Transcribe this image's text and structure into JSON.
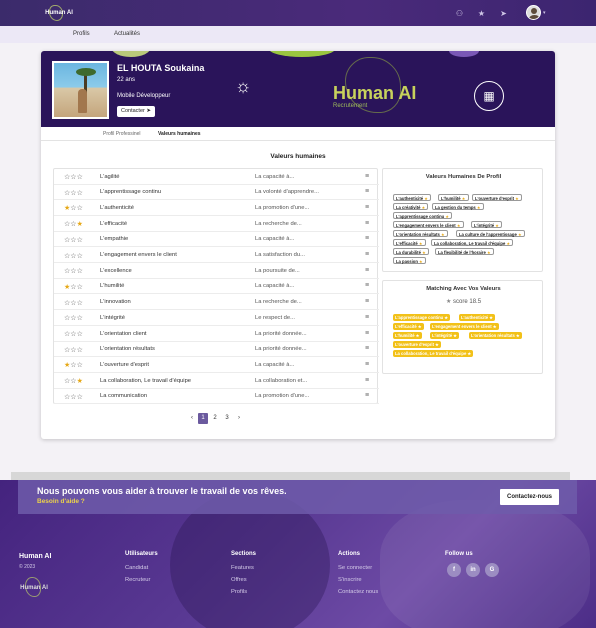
{
  "topbar": {
    "logo": "Human AI",
    "icons": [
      "add-user-icon",
      "star-icon",
      "send-icon"
    ],
    "caret": "▾"
  },
  "subnav": {
    "items": [
      "Profils",
      "Actualités"
    ]
  },
  "profile": {
    "name": "EL HOUTA Soukaina",
    "age": "22 ans",
    "role": "Mobile Développeur",
    "contact": "Contacter"
  },
  "brand": {
    "title": "Human AI",
    "subtitle": "Recrutement"
  },
  "tabs": [
    "Profil Professinel",
    "Valeurs humaines"
  ],
  "section_title": "Valeurs humaines",
  "values": [
    {
      "label": "L'agilité",
      "desc": "La capacité à...",
      "stars": 0
    },
    {
      "label": "L'apprentissage continu",
      "desc": "La volonté d'apprendre...",
      "stars": 0
    },
    {
      "label": "L'authenticité",
      "desc": "La promotion d'une...",
      "stars": 1
    },
    {
      "label": "L'efficacité",
      "desc": "La recherche de...",
      "stars": 3
    },
    {
      "label": "L'empathie",
      "desc": "La capacité à...",
      "stars": 0
    },
    {
      "label": "L'engagement envers le client",
      "desc": "La satisfaction du...",
      "stars": 0
    },
    {
      "label": "L'excellence",
      "desc": "La poursuite de...",
      "stars": 0
    },
    {
      "label": "L'humilité",
      "desc": "La capacité à...",
      "stars": 1
    },
    {
      "label": "L'innovation",
      "desc": "La recherche de...",
      "stars": 0
    },
    {
      "label": "L'intégrité",
      "desc": "Le respect de...",
      "stars": 0
    },
    {
      "label": "L'orientation client",
      "desc": "La priorité donnée...",
      "stars": 0
    },
    {
      "label": "L'orientation résultats",
      "desc": "La priorité donnée...",
      "stars": 0
    },
    {
      "label": "L'ouverture d'esprit",
      "desc": "La capacité à...",
      "stars": 1
    },
    {
      "label": "La collaboration, Le travail d'équipe",
      "desc": "La collaboration et...",
      "stars": 3
    },
    {
      "label": "La communication",
      "desc": "La promotion d'une...",
      "stars": 0
    }
  ],
  "pager": {
    "prev": "‹",
    "pages": [
      "1",
      "2",
      "3"
    ],
    "next": "›"
  },
  "profile_values": {
    "title": "Valeurs Humaines De Profil",
    "tags": [
      "L'authenticité",
      "L'humilité",
      "L'ouverture d'esprit",
      "La créativité",
      "La gestion du temps",
      "L'apprentissage continu",
      "L'engagement envers le client",
      "L'intégrité",
      "L'orientation résultats",
      "La culture de l'apprentissage",
      "L'efficacité",
      "La collaboration, Le travail d'équipe",
      "La durabilité",
      "La flexibilité de l'horaire",
      "La passion"
    ]
  },
  "matching": {
    "title": "Matching Avec Vos Valeurs",
    "score_label": "score",
    "score": "18.5",
    "tags": [
      "L'apprentissage continu",
      "L'authenticité",
      "L'efficacité",
      "L'engagement envers le client",
      "L'humilité",
      "L'intégrité",
      "L'orientation résultats",
      "L'ouverture d'esprit",
      "La collaboration, Le travail d'équipe"
    ]
  },
  "cta": {
    "title": "Nous pouvons vous aider à trouver le travail de vos rêves.",
    "subtitle": "Besoin d'aide ?",
    "button": "Contactez-nous"
  },
  "footer": {
    "brand": "Human AI",
    "year": "© 2023",
    "cols": [
      {
        "head": "Utilisateurs",
        "items": [
          "Candidat",
          "Recruteur"
        ]
      },
      {
        "head": "Sections",
        "items": [
          "Features",
          "Offres",
          "Profils"
        ]
      },
      {
        "head": "Actions",
        "items": [
          "Se connecter",
          "S'inscrire",
          "Contactez nous"
        ]
      }
    ],
    "follow": "Follow us",
    "social": [
      "facebook-icon",
      "linkedin-icon",
      "google-icon"
    ]
  }
}
